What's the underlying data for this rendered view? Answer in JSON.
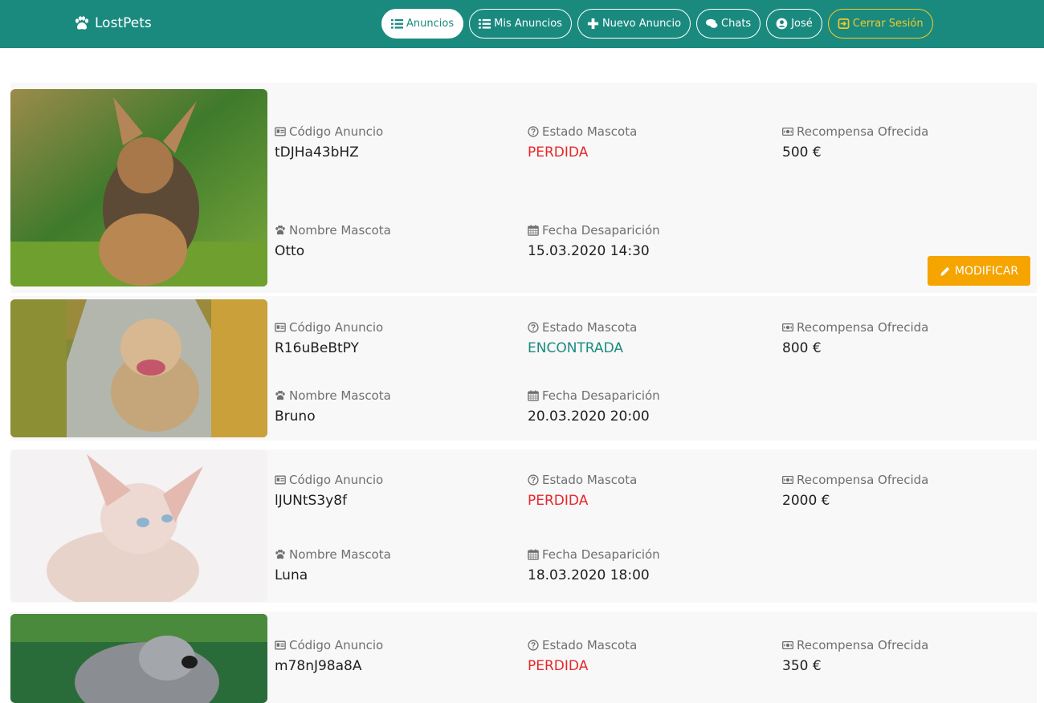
{
  "brand": "LostPets",
  "nav": {
    "anuncios": "Anuncios",
    "mis_anuncios": "Mis Anuncios",
    "nuevo_anuncio": "Nuevo Anuncio",
    "chats": "Chats",
    "user": "José",
    "logout": "Cerrar Sesión"
  },
  "labels": {
    "codigo": "Código Anuncio",
    "estado": "Estado Mascota",
    "recompensa": "Recompensa Ofrecida",
    "nombre": "Nombre Mascota",
    "fecha": "Fecha Desaparición",
    "modificar": "MODIFICAR"
  },
  "listings": [
    {
      "codigo": "tDJHa43bHZ",
      "estado": "PERDIDA",
      "recompensa": "500 €",
      "nombre": "Otto",
      "fecha": "15.03.2020 14:30"
    },
    {
      "codigo": "R16uBeBtPY",
      "estado": "ENCONTRADA",
      "recompensa": "800 €",
      "nombre": "Bruno",
      "fecha": "20.03.2020 20:00"
    },
    {
      "codigo": "lJUNtS3y8f",
      "estado": "PERDIDA",
      "recompensa": "2000 €",
      "nombre": "Luna",
      "fecha": "18.03.2020 18:00"
    },
    {
      "codigo": "m78nJ98a8A",
      "estado": "PERDIDA",
      "recompensa": "350 €"
    }
  ],
  "colors": {
    "primary": "#1a8a7f",
    "lost": "#e8262a",
    "found": "#1a8a7f",
    "warning": "#f5a400",
    "logout": "#f3c928"
  }
}
